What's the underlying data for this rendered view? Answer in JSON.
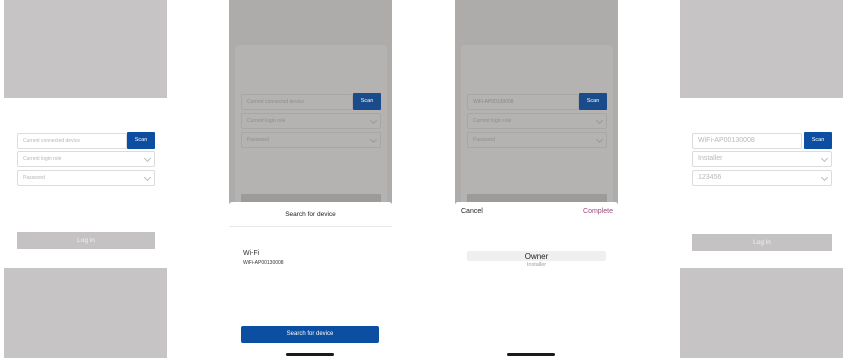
{
  "screen1": {
    "device_placeholder": "Current connected device",
    "scan_label": "Scan",
    "role_placeholder": "Current login role",
    "password_placeholder": "Password",
    "login_label": "Log in"
  },
  "screen2": {
    "device_placeholder": "Current connected device",
    "scan_label": "Scan",
    "role_placeholder": "Current login role",
    "password_placeholder": "Password",
    "sheet_title": "Search for device",
    "wifi_heading": "Wi-Fi",
    "wifi_device": "WiFi-AP00130008",
    "search_button": "Search for device"
  },
  "screen3": {
    "device_value": "WiFi-AP00130008",
    "scan_label": "Scan",
    "role_placeholder": "Current login role",
    "password_placeholder": "Password",
    "cancel_label": "Cancel",
    "complete_label": "Complete",
    "picker_options": [
      "Owner",
      "Installer"
    ]
  },
  "screen4": {
    "device_value": "WiFi-AP00130008",
    "scan_label": "Scan",
    "role_value": "Installer",
    "password_value": "123456",
    "login_label": "Log in"
  },
  "colors": {
    "accent": "#0b4ea2",
    "gray_band": "#c6c4c4",
    "dim_overlay": "#adacab",
    "login_button": "#c4c2c2",
    "complete_text": "#9a4a7a"
  }
}
